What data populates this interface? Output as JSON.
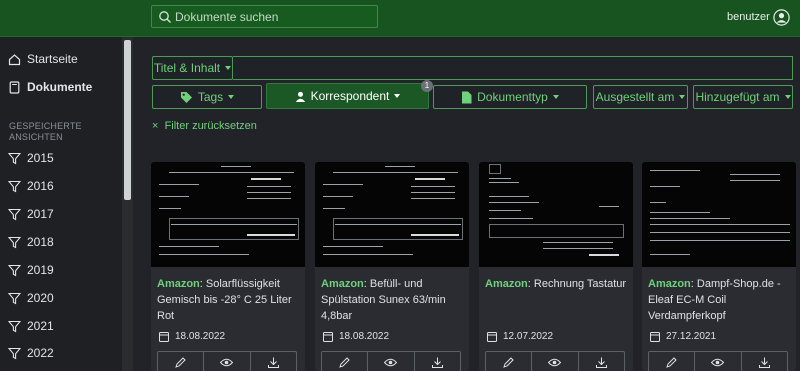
{
  "header": {
    "search_placeholder": "Dokumente suchen",
    "user": "benutzer"
  },
  "sidebar": {
    "items": [
      {
        "label": "Startseite",
        "icon": "house-icon"
      },
      {
        "label": "Dokumente",
        "icon": "document-icon"
      }
    ],
    "saved_views_caption": "GESPEICHERTE ANSICHTEN",
    "saved_views": [
      "2015",
      "2016",
      "2017",
      "2018",
      "2019",
      "2020",
      "2021",
      "2022"
    ]
  },
  "filters": {
    "title_content": "Titel & Inhalt",
    "tags": "Tags",
    "correspondent": "Korrespondent",
    "correspondent_count": "1",
    "document_type": "Dokumenttyp",
    "issued": "Ausgestellt am",
    "added": "Hinzugefügt am",
    "reset": "Filter zurücksetzen"
  },
  "documents": [
    {
      "correspondent": "Amazon",
      "title": "Solarflüssigkeit Gemisch bis -28° C 25 Liter Rot",
      "date": "18.08.2022"
    },
    {
      "correspondent": "Amazon",
      "title": "Befüll- und Spülstation Sunex 63/min 4,8bar",
      "date": "18.08.2022"
    },
    {
      "correspondent": "Amazon",
      "title": "Rechnung Tastatur",
      "date": "12.07.2022"
    },
    {
      "correspondent": "Amazon",
      "title": "Dampf-Shop.de - Eleaf EC-M Coil Verdampferkopf",
      "date": "27.12.2021"
    }
  ],
  "colors": {
    "header_bg": "#17541f",
    "accent": "#6fd17b",
    "selected_filter": "#1b5826"
  }
}
